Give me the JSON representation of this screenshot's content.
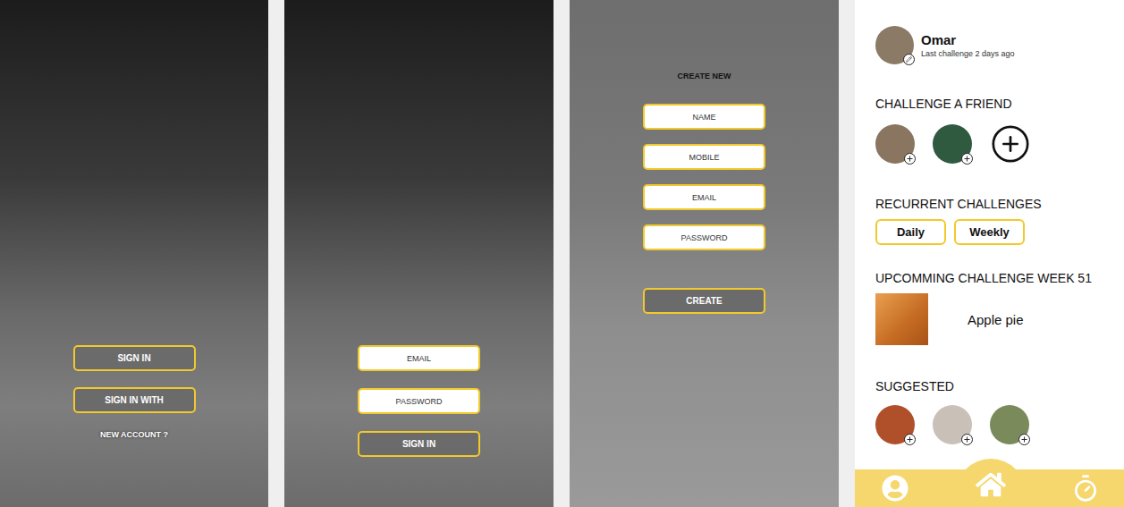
{
  "welcome": {
    "buttons": [
      "SIGN IN",
      "SIGN IN WITH"
    ],
    "link": "NEW ACCOUNT ?"
  },
  "sign_in": {
    "fields": [
      "EMAIL",
      "PASSWORD"
    ],
    "button": "SIGN IN"
  },
  "create_account": {
    "title": "CREATE NEW",
    "fields": [
      "NAME",
      "MOBILE",
      "EMAIL",
      "PASSWORD"
    ],
    "button": "CREATE"
  },
  "home": {
    "profile": {
      "name": "Omar",
      "subtitle": "Last challenge 2 days ago",
      "color": "#8b7a66"
    },
    "challenge_title": "CHALLENGE A FRIEND",
    "friends": [
      {
        "color": "#8a7560"
      },
      {
        "color": "#2f5a3f"
      }
    ],
    "recurrent_title": "RECURRENT CHALLENGES",
    "recurrent": [
      "Daily",
      "Weekly"
    ],
    "upcoming_title": "UPCOMMING CHALLENGE WEEK 51",
    "upcoming": {
      "name": "Apple pie"
    },
    "suggested_title": "SUGGESTED",
    "suggested": [
      {
        "color": "#b0502a"
      },
      {
        "color": "#c9c0b8"
      },
      {
        "color": "#7a8a5a"
      }
    ],
    "nav": [
      {
        "selected": false
      },
      {
        "selected": true
      },
      {
        "selected": false
      }
    ]
  }
}
